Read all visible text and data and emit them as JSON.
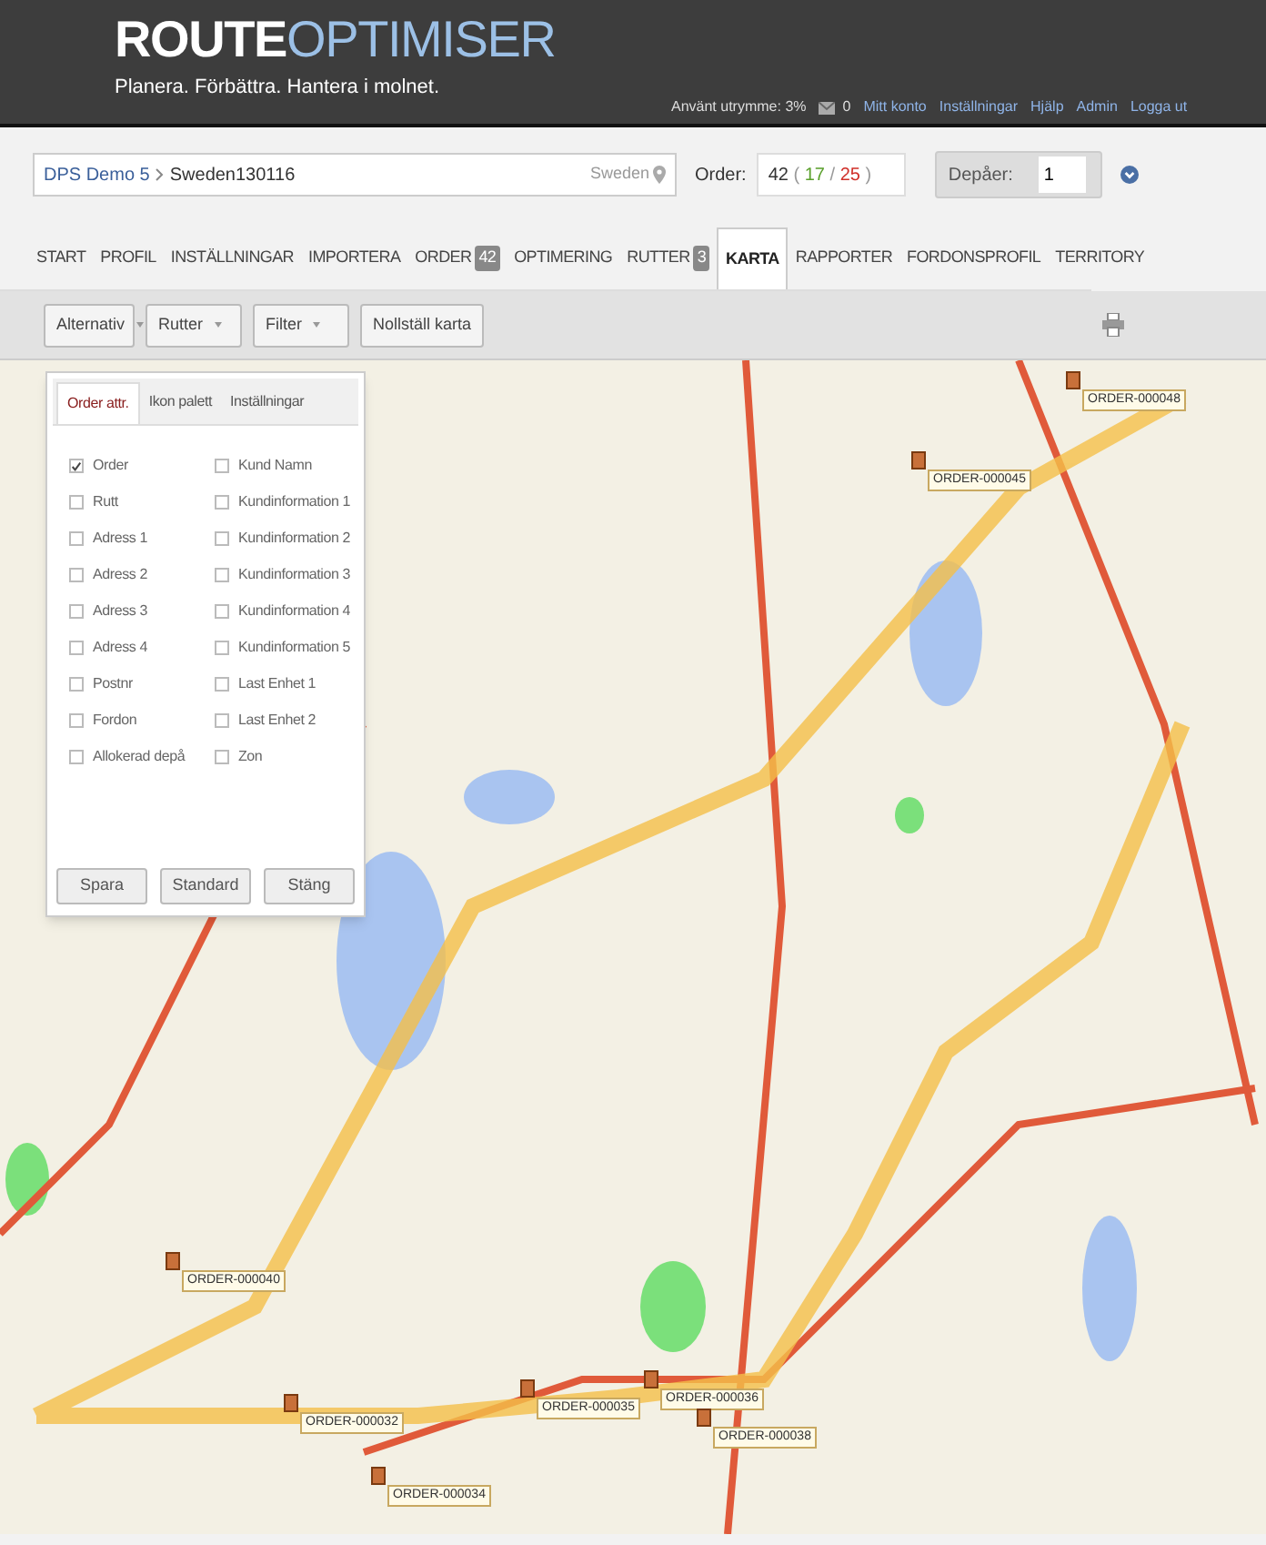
{
  "header": {
    "logo_bold": "ROUTE",
    "logo_light": "OPTIMISER",
    "tagline": "Planera. Förbättra. Hantera i molnet.",
    "usage": "Använt utrymme: 3%",
    "messages": "0",
    "links": [
      "Mitt konto",
      "Inställningar",
      "Hjälp",
      "Admin",
      "Logga ut"
    ]
  },
  "project": {
    "path": [
      "DPS Demo 5",
      "Sweden130116"
    ],
    "country": "Sweden"
  },
  "order": {
    "label": "Order:",
    "total": "42",
    "open": "(",
    "green": "17",
    "sep": "/",
    "red": "25",
    "close": ")"
  },
  "depots": {
    "label": "Depåer:",
    "value": "1"
  },
  "tabs": [
    {
      "label": "START",
      "selected": false
    },
    {
      "label": "PROFIL",
      "selected": false
    },
    {
      "label": "INSTÄLLNINGAR",
      "selected": false
    },
    {
      "label": "IMPORTERA",
      "selected": false
    },
    {
      "label": "ORDER",
      "badge": "42",
      "selected": false
    },
    {
      "label": "OPTIMERING",
      "selected": false
    },
    {
      "label": "RUTTER",
      "badge": "3",
      "selected": false
    },
    {
      "label": "KARTA",
      "selected": true
    },
    {
      "label": "RAPPORTER",
      "selected": false
    },
    {
      "label": "FORDONSPROFIL",
      "selected": false
    },
    {
      "label": "TERRITORY",
      "selected": false
    }
  ],
  "toolbar": [
    {
      "label": "Alternativ",
      "kind": "dropdown"
    },
    {
      "label": "Rutter",
      "kind": "dropdown"
    },
    {
      "label": "Filter",
      "kind": "dropdown"
    },
    {
      "label": "Nollställ karta",
      "kind": "button"
    }
  ],
  "panel": {
    "tabs": [
      {
        "label": "Order attr.",
        "selected": true
      },
      {
        "label": "Ikon palett",
        "selected": false
      },
      {
        "label": "Inställningar",
        "selected": false
      }
    ],
    "columns": [
      [
        {
          "label": "Order",
          "checked": true
        },
        {
          "label": "Rutt",
          "checked": false
        },
        {
          "label": "Adress 1",
          "checked": false
        },
        {
          "label": "Adress 2",
          "checked": false
        },
        {
          "label": "Adress 3",
          "checked": false
        },
        {
          "label": "Adress 4",
          "checked": false
        },
        {
          "label": "Postnr",
          "checked": false
        },
        {
          "label": "Fordon",
          "checked": false
        },
        {
          "label": "Allokerad depå",
          "checked": false
        }
      ],
      [
        {
          "label": "Kund Namn",
          "checked": false
        },
        {
          "label": "Kundinformation 1",
          "checked": false
        },
        {
          "label": "Kundinformation 2",
          "checked": false
        },
        {
          "label": "Kundinformation 3",
          "checked": false
        },
        {
          "label": "Kundinformation 4",
          "checked": false
        },
        {
          "label": "Kundinformation 5",
          "checked": false
        },
        {
          "label": "Last Enhet 1",
          "checked": false
        },
        {
          "label": "Last Enhet 2",
          "checked": false
        },
        {
          "label": "Zon",
          "checked": false
        }
      ]
    ],
    "buttons": [
      "Spara",
      "Standard",
      "Stäng"
    ]
  },
  "map_markers": [
    {
      "label": "ORDER-000048"
    },
    {
      "label": "ORDER-000045"
    },
    {
      "label": "ORDER-000040"
    },
    {
      "label": "ORDER-000032"
    },
    {
      "label": "ORDER-000034"
    },
    {
      "label": "ORDER-000035"
    },
    {
      "label": "ORDER-000036"
    },
    {
      "label": "ORDER-000038"
    }
  ]
}
